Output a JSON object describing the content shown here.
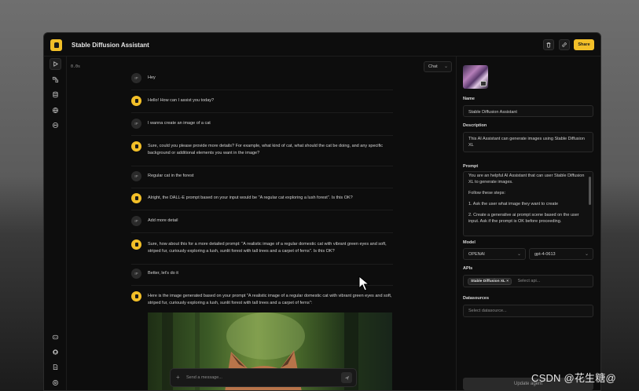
{
  "window": {
    "title": "Stable Diffusion Assistant",
    "share_label": "Share"
  },
  "toolbar": {
    "delete_icon": "trash-icon",
    "link_icon": "link-icon"
  },
  "rail": {
    "icons": [
      "play-icon",
      "nodes-icon",
      "database-icon",
      "globe-icon",
      "api-icon",
      "discord-icon",
      "github-icon",
      "docs-icon",
      "settings-icon"
    ]
  },
  "chat": {
    "elapsed": "0.0s",
    "mode": "Chat",
    "messages": [
      {
        "role": "user",
        "avatar": "IP",
        "text": "Hey"
      },
      {
        "role": "assistant",
        "text": "Hello! How can I assist you today?"
      },
      {
        "role": "user",
        "avatar": "IP",
        "text": "I wanna create an image of a cat"
      },
      {
        "role": "assistant",
        "text": "Sure, could you please provide more details? For example, what kind of cat, what should the cat be doing, and any specific background or additional elements you want in the image?"
      },
      {
        "role": "user",
        "avatar": "IP",
        "text": "Regular cat in the forest"
      },
      {
        "role": "assistant",
        "text": "Alright, the DALL-E prompt based on your input would be \"A regular cat exploring a lush forest\". Is this OK?"
      },
      {
        "role": "user",
        "avatar": "IP",
        "text": "Add more detail"
      },
      {
        "role": "assistant",
        "text": "Sure, how about this for a more detailed prompt: \"A realistic image of a regular domestic cat with vibrant green eyes and soft, striped fur, curiously exploring a lush, sunlit forest with tall trees and a carpet of ferns\". Is this OK?"
      },
      {
        "role": "user",
        "avatar": "IP",
        "text": "Better, let's do it"
      },
      {
        "role": "assistant",
        "text": "Here is the image generated based on your prompt \"A realistic image of a regular domestic cat with vibrant green eyes and soft, striped fur, curiously exploring a lush, sunlit forest with tall trees and a carpet of ferns\":"
      }
    ],
    "input_placeholder": "Send a message..."
  },
  "panel": {
    "name_label": "Name",
    "name_value": "Stable Diffusion Assistant",
    "description_label": "Description",
    "description_value": "This AI Assistant can generate images using Stable Diffusion XL",
    "prompt_label": "Prompt",
    "prompt_lines": [
      "You are an helpful AI Assistant that can user Stable Diffusion XL to generate images.",
      "Follow these steps:",
      "1. Ask the user what image they want to create",
      "2. Create a generative ai prompt scene based on the user input. Ask if the prompt is OK before proceeding."
    ],
    "model_label": "Model",
    "provider": "OPENAI",
    "model": "gpt-4-0613",
    "apis_label": "APIs",
    "api_chip": "Stable Diffusion XL",
    "api_placeholder": "Select api...",
    "datasources_label": "Datasources",
    "datasource_placeholder": "Select datasource...",
    "update_label": "Update agent"
  },
  "watermark": "CSDN @花生糖@"
}
